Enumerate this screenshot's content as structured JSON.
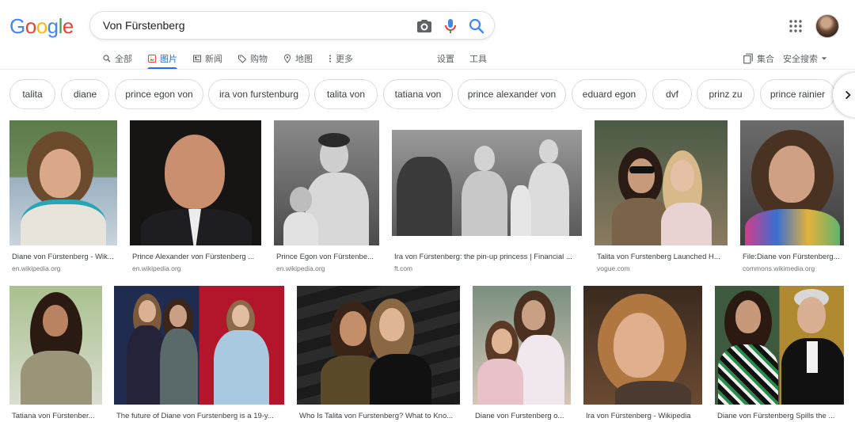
{
  "header": {
    "logo_letters": [
      "G",
      "o",
      "o",
      "g",
      "l",
      "e"
    ],
    "search_query": "Von Fürstenberg"
  },
  "tabs": [
    {
      "label": "全部",
      "icon": "search-icon"
    },
    {
      "label": "图片",
      "icon": "image-icon"
    },
    {
      "label": "新闻",
      "icon": "news-icon"
    },
    {
      "label": "购物",
      "icon": "tag-icon"
    },
    {
      "label": "地图",
      "icon": "map-pin-icon"
    },
    {
      "label": "更多",
      "icon": "more-vert-icon"
    },
    {
      "label": "设置"
    },
    {
      "label": "工具"
    },
    {
      "label": "集合",
      "icon": "bookmark-icon"
    },
    {
      "label": "安全搜索",
      "icon": "caret-down-icon"
    }
  ],
  "chips": [
    "talita",
    "diane",
    "prince egon von",
    "ira von furstenburg",
    "talita von",
    "tatiana von",
    "prince alexander von",
    "eduard egon",
    "dvf",
    "prinz zu",
    "prince rainier"
  ],
  "results_row1": [
    {
      "caption": "Diane von Fürstenberg - Wik...",
      "source": "en.wikipedia.org"
    },
    {
      "caption": "Prince Alexander von Fürstenberg ...",
      "source": "en.wikipedia.org"
    },
    {
      "caption": "Prince Egon von Fürstenbe...",
      "source": "en.wikipedia.org"
    },
    {
      "caption": "Ira von Fürstenberg: the pin-up princess | Financial ...",
      "source": "ft.com"
    },
    {
      "caption": "Talita von Furstenberg Launched H...",
      "source": "vogue.com"
    },
    {
      "caption": "File:Diane von Fürstenberg...",
      "source": "commons.wikimedia.org"
    }
  ],
  "results_row2": [
    {
      "caption": "Tatiana von Fürstenber..."
    },
    {
      "caption": "The future of Diane von Furstenberg is a 19-y..."
    },
    {
      "caption": "Who Is Talita von Furstenberg? What to Kno..."
    },
    {
      "caption": "Diane von Furstenberg o..."
    },
    {
      "caption": "Ira von Fürstenberg - Wikipedia"
    },
    {
      "caption": "Diane von Fürstenberg Spills the ..."
    }
  ],
  "colors": {
    "accent": "#1a73e8",
    "logo": [
      "#4285f4",
      "#ea4335",
      "#fbbc05",
      "#4285f4",
      "#34a853",
      "#ea4335"
    ]
  }
}
